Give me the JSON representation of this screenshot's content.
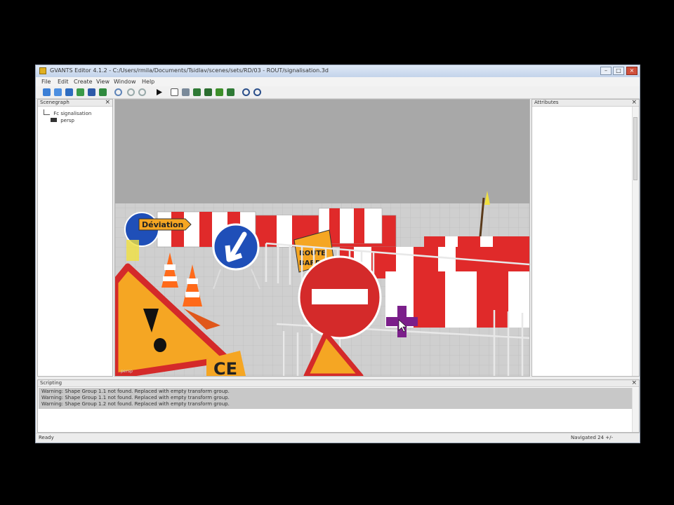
{
  "window": {
    "title": "GVANTS Editor 4.1.2 - C:/Users/rmila/Documents/Tsidlav/scenes/sets/RD/03 - ROUT/signalisation.3d",
    "minimize_glyph": "–",
    "maximize_glyph": "□",
    "close_glyph": "×"
  },
  "menu": [
    {
      "label": "File"
    },
    {
      "label": "Edit"
    },
    {
      "label": "Create"
    },
    {
      "label": "View"
    },
    {
      "label": "Window"
    },
    {
      "label": "Help"
    }
  ],
  "toolbar": {
    "icons": [
      "new-icon",
      "open-icon",
      "save-icon",
      "save-as-icon",
      "export-icon",
      "import-icon",
      "undo-icon",
      "redo-icon",
      "play-icon",
      "select-icon",
      "camera-icon",
      "chart-icon",
      "chart-icon",
      "tree-icon",
      "chart-icon",
      "settings-icon",
      "settings-icon"
    ]
  },
  "scenegraph": {
    "title": "Scenegraph",
    "close_glyph": "×",
    "items": [
      {
        "label": "Fc signalisation",
        "icon": "node-icon"
      },
      {
        "label": "persp",
        "icon": "camera-icon"
      }
    ]
  },
  "viewport": {
    "scene": {
      "deviation_label": "Déviation",
      "route_label_1": "ROUTE",
      "route_label_2": "BARR",
      "partial_word": "CE"
    },
    "corner_label": "persp"
  },
  "attributes": {
    "title": "Attributes",
    "close_glyph": "×"
  },
  "scripting": {
    "title": "Scripting",
    "close_glyph": "×",
    "lines": [
      "Warning: Shape Group 1.1 not found. Replaced with empty transform group.",
      "Warning: Shape Group 1.1 not found. Replaced with empty transform group.",
      "Warning: Shape Group 1.2 not found. Replaced with empty transform group."
    ]
  },
  "status": {
    "left": "Ready",
    "right": "Navigated 24 +/-"
  },
  "colors": {
    "background": "#000000",
    "viewport_sky": "#a8a8a8",
    "ground": "#cfcfcf",
    "warning_orange": "#f5a623",
    "sign_blue": "#1f4fb8",
    "sign_red": "#d42a2a",
    "barrier_red": "#e02a2a",
    "cursor_purple": "#7b1f8a"
  }
}
